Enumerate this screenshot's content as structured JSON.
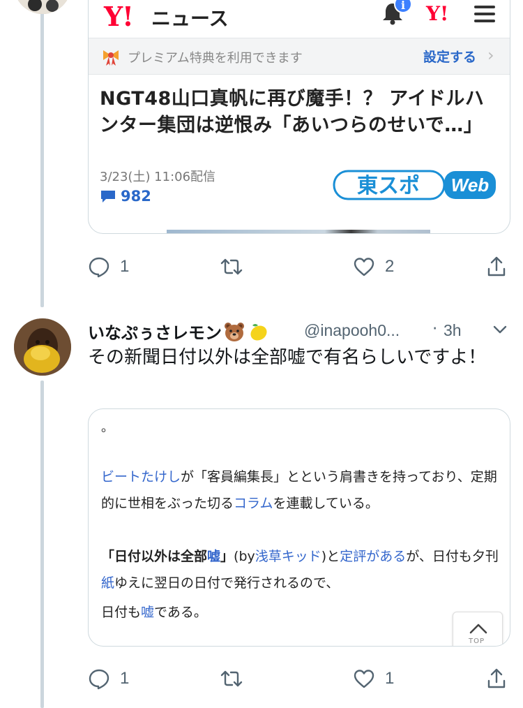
{
  "embedded_article": {
    "site_logo": "Y!",
    "site_name": "ニュース",
    "notification_badge": "i",
    "yahoo_short_logo": "Y!",
    "premium_text": "プレミアム特典を利用できます",
    "premium_link": "設定する",
    "premium_chevron": "›",
    "headline": "NGT48山口真帆に再び魔手！？ アイドルハンター集団は逆恨み「あいつらのせいで…」",
    "date": "3/23(土) 11:06配信",
    "comment_count": "982",
    "source_logo_text": "東スポ",
    "source_logo_web": "Web"
  },
  "first_tweet_actions": {
    "reply_count": "1",
    "retweet_count": "",
    "like_count": "2"
  },
  "tweet": {
    "display_name": "いなぷぅさレモン",
    "emojis": [
      "bear-face-icon",
      "lemon-icon"
    ],
    "handle": "@inapooh0...",
    "separator": "·",
    "time": "3h",
    "text": "その新聞日付以外は全部嘘で有名らしいですよ！"
  },
  "embedded_wiki": {
    "lead": "。",
    "p1_link1": "ビートたけし",
    "p1_text1": "が「客員編集長」とという肩書きを持っており、定期的に世相をぶった切る",
    "p1_link2": "コラム",
    "p1_text2": "を連載している。",
    "p2_bold1": "「日付以外は全部",
    "p2_bold_link": "嘘",
    "p2_bold2": "」",
    "p2_text1": "(by",
    "p2_link1": "浅草キッド",
    "p2_text2": ")と",
    "p2_link2": "定評がある",
    "p2_text3": "が、日付も夕刊",
    "p2_link3": "紙",
    "p2_text4": "ゆえに翌日の日付で発行されるので、",
    "p3_text1": "日付も",
    "p3_link1": "嘘",
    "p3_text2": "である。",
    "top_button_label": "TOP"
  },
  "second_tweet_actions": {
    "reply_count": "1",
    "retweet_count": "",
    "like_count": "1"
  },
  "colors": {
    "yahoo_red": "#ff0033",
    "link_blue": "#3366cc",
    "twitter_gray": "#536471",
    "thread_line": "#ccd6dd",
    "card_border": "#cfd9de"
  }
}
